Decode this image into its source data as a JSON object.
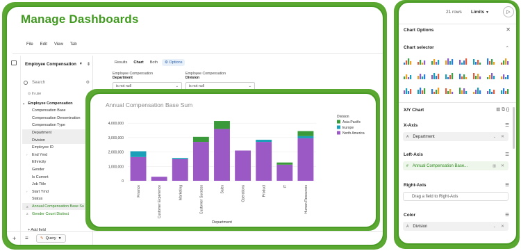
{
  "app": {
    "title": "Manage Dashboards",
    "menu": [
      "File",
      "Edit",
      "View",
      "Tab"
    ]
  },
  "explore": {
    "dataset": "Employee Compensation",
    "search_placeholder": "Search",
    "in_use_label": "In use",
    "group": {
      "name": "Employee Compensation",
      "count": "3"
    },
    "fields": [
      {
        "name": "Compensation Base",
        "glyph": "",
        "state": ""
      },
      {
        "name": "Compensation Denomination",
        "glyph": "",
        "state": ""
      },
      {
        "name": "Compensation Type",
        "glyph": "",
        "state": ""
      },
      {
        "name": "Department",
        "glyph": "",
        "state": "sel"
      },
      {
        "name": "Division",
        "glyph": "",
        "state": "sel"
      },
      {
        "name": "Employee ID",
        "glyph": "",
        "state": ""
      },
      {
        "name": "End Ymd",
        "glyph": "›",
        "state": ""
      },
      {
        "name": "Ethnicity",
        "glyph": "",
        "state": ""
      },
      {
        "name": "Gender",
        "glyph": "",
        "state": ""
      },
      {
        "name": "Is Current",
        "glyph": "",
        "state": ""
      },
      {
        "name": "Job Title",
        "glyph": "",
        "state": ""
      },
      {
        "name": "Start Ymd",
        "glyph": "›",
        "state": ""
      },
      {
        "name": "Status",
        "glyph": "",
        "state": ""
      },
      {
        "name": "Annual Compensation Base Su",
        "glyph": "Σ",
        "state": "sel green"
      },
      {
        "name": "Gender Count Distinct",
        "glyph": "Σ",
        "state": "green"
      }
    ],
    "add_field": "+ Add field",
    "bottom_tab": "Query"
  },
  "view_tabs": {
    "results": "Results",
    "chart": "Chart",
    "both": "Both",
    "options": "Options"
  },
  "filters": [
    {
      "source": "Employee Compensation",
      "field": "Department",
      "operator": "is not null"
    },
    {
      "source": "Employee Compensation",
      "field": "Division",
      "operator": "is not null"
    }
  ],
  "chart_data": {
    "type": "bar",
    "title": "Annual Compensation Base Sum",
    "xlabel": "Department",
    "ylabel": "",
    "ylim": [
      0,
      4200000
    ],
    "yticks": [
      "0",
      "1,000,000",
      "2,000,000",
      "3,000,000",
      "4,000,000"
    ],
    "ytick_values": [
      0,
      1000000,
      2000000,
      3000000,
      4000000
    ],
    "legend_title": "Division",
    "legend_position": "right",
    "categories": [
      "Finance",
      "Customer Experience",
      "Marketing",
      "Customer Success",
      "Sales",
      "Operations",
      "Product",
      "IT",
      "Human Resources"
    ],
    "series": [
      {
        "name": "North America",
        "color": "#9b59c6",
        "values": [
          1650000,
          280000,
          1500000,
          2700000,
          3600000,
          2100000,
          2700000,
          1120000,
          2950000
        ]
      },
      {
        "name": "Europe",
        "color": "#1a9fb8",
        "values": [
          400000,
          0,
          80000,
          0,
          0,
          0,
          150000,
          0,
          150000
        ]
      },
      {
        "name": "Asia-Pacific",
        "color": "#3a9a3a",
        "values": [
          0,
          0,
          0,
          350000,
          550000,
          0,
          0,
          150000,
          350000
        ]
      }
    ],
    "legend_order": [
      "Asia-Pacific",
      "Europe",
      "North America"
    ],
    "grid": true
  },
  "options_panel": {
    "rows": "21 rows",
    "limits": "Limits",
    "title": "Chart Options",
    "chart_selector": "Chart selector",
    "chart_type_label": "X/Y Chart",
    "x_axis": {
      "title": "X-Axis",
      "field": "Department"
    },
    "left_axis": {
      "title": "Left-Axis",
      "field": "Annual Compensation Base..."
    },
    "right_axis": {
      "title": "Right-Axis",
      "placeholder": "Drag a field to Right-Axis"
    },
    "color": {
      "title": "Color",
      "field": "Division"
    }
  }
}
